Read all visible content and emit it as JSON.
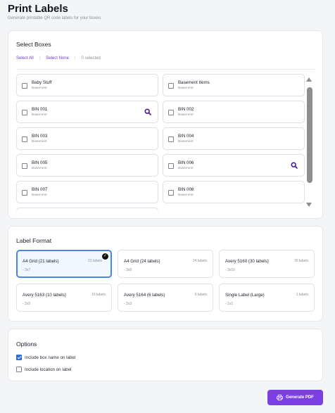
{
  "header": {
    "title": "Print Labels",
    "subtitle": "Generate printable QR code labels for your boxes."
  },
  "select_boxes": {
    "title": "Select Boxes",
    "select_all": "Select All",
    "select_none": "Select None",
    "selected_count": "0 selected",
    "boxes": [
      {
        "name": "Baby Stuff",
        "location": "Basement",
        "checked": false
      },
      {
        "name": "Basement Items",
        "location": "Basement",
        "checked": false
      },
      {
        "name": "BIN 001",
        "location": "Basement",
        "checked": false
      },
      {
        "name": "BIN 002",
        "location": "Basement",
        "checked": false
      },
      {
        "name": "BIN 003",
        "location": "Basement",
        "checked": false
      },
      {
        "name": "BIN 004",
        "location": "Basement",
        "checked": false
      },
      {
        "name": "BIN 005",
        "location": "Basement",
        "checked": false
      },
      {
        "name": "BIN 006",
        "location": "Basement",
        "checked": false
      },
      {
        "name": "BIN 007",
        "location": "Basement",
        "checked": false
      },
      {
        "name": "BIN 008",
        "location": "Basement",
        "checked": false
      }
    ]
  },
  "label_format": {
    "title": "Label Format",
    "formats": [
      {
        "name": "A4 Grid (21 labels)",
        "count": "21 labels",
        "grid": "- 3x7",
        "selected": true
      },
      {
        "name": "A4 Grid (24 labels)",
        "count": "24 labels",
        "grid": "- 3x8",
        "selected": false
      },
      {
        "name": "Avery 5160 (30 labels)",
        "count": "30 labels",
        "grid": "- 3x10",
        "selected": false
      },
      {
        "name": "Avery 5163 (10 labels)",
        "count": "10 labels",
        "grid": "- 2x5",
        "selected": false
      },
      {
        "name": "Avery 5164 (6 labels)",
        "count": "6 labels",
        "grid": "- 2x3",
        "selected": false
      },
      {
        "name": "Single Label (Large)",
        "count": "1 labels",
        "grid": "- 1x1",
        "selected": false
      }
    ]
  },
  "options": {
    "title": "Options",
    "include_box_name": {
      "label": "Include box name on label",
      "checked": true
    },
    "include_location": {
      "label": "Include location on label",
      "checked": false
    }
  },
  "actions": {
    "generate_pdf": "Generate PDF"
  },
  "colors": {
    "accent": "#7b3fe4",
    "link": "#6a3bd6",
    "selected_border": "#4a86e8",
    "checkbox_checked": "#2a6fdb"
  },
  "icons": {
    "search": "search-icon",
    "printer": "printer-icon",
    "check": "check-icon"
  }
}
